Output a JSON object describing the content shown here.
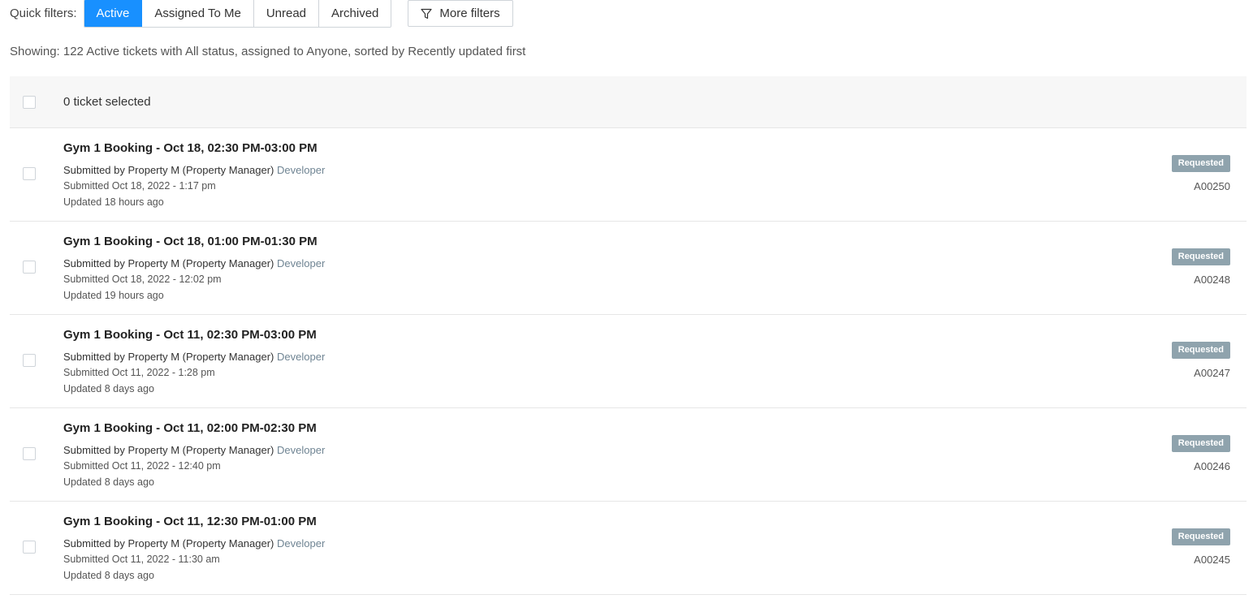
{
  "filters": {
    "label": "Quick filters:",
    "options": [
      {
        "label": "Active",
        "active": true
      },
      {
        "label": "Assigned To Me",
        "active": false
      },
      {
        "label": "Unread",
        "active": false
      },
      {
        "label": "Archived",
        "active": false
      }
    ],
    "more_label": "More filters"
  },
  "summary": "Showing: 122 Active tickets with All status, assigned to Anyone, sorted by Recently updated first",
  "selection": {
    "count_label": "0 ticket selected"
  },
  "tickets": [
    {
      "title": "Gym 1 Booking - Oct 18, 02:30 PM-03:00 PM",
      "submitter": "Submitted by Property M (Property Manager)",
      "role": "Developer",
      "submitted": "Submitted Oct 18, 2022 - 1:17 pm",
      "updated": "Updated 18 hours ago",
      "status": "Requested",
      "id": "A00250"
    },
    {
      "title": "Gym 1 Booking - Oct 18, 01:00 PM-01:30 PM",
      "submitter": "Submitted by Property M (Property Manager)",
      "role": "Developer",
      "submitted": "Submitted Oct 18, 2022 - 12:02 pm",
      "updated": "Updated 19 hours ago",
      "status": "Requested",
      "id": "A00248"
    },
    {
      "title": "Gym 1 Booking - Oct 11, 02:30 PM-03:00 PM",
      "submitter": "Submitted by Property M (Property Manager)",
      "role": "Developer",
      "submitted": "Submitted Oct 11, 2022 - 1:28 pm",
      "updated": "Updated 8 days ago",
      "status": "Requested",
      "id": "A00247"
    },
    {
      "title": "Gym 1 Booking - Oct 11, 02:00 PM-02:30 PM",
      "submitter": "Submitted by Property M (Property Manager)",
      "role": "Developer",
      "submitted": "Submitted Oct 11, 2022 - 12:40 pm",
      "updated": "Updated 8 days ago",
      "status": "Requested",
      "id": "A00246"
    },
    {
      "title": "Gym 1 Booking - Oct 11, 12:30 PM-01:00 PM",
      "submitter": "Submitted by Property M (Property Manager)",
      "role": "Developer",
      "submitted": "Submitted Oct 11, 2022 - 11:30 am",
      "updated": "Updated 8 days ago",
      "status": "Requested",
      "id": "A00245"
    }
  ]
}
